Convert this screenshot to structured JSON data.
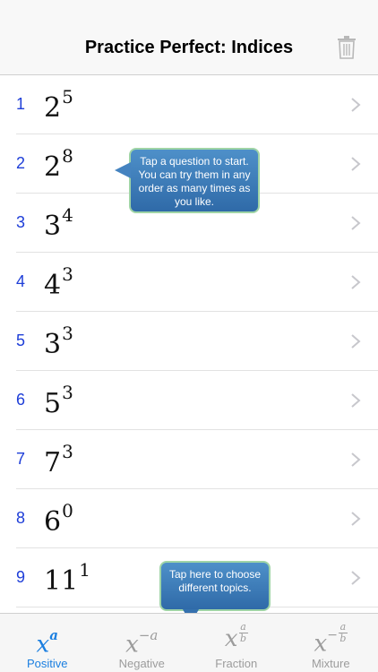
{
  "nav": {
    "title": "Practice Perfect: Indices",
    "trash_icon": "trash-icon"
  },
  "questions": [
    {
      "num": "1",
      "base": "2",
      "exp": "5"
    },
    {
      "num": "2",
      "base": "2",
      "exp": "8"
    },
    {
      "num": "3",
      "base": "3",
      "exp": "4"
    },
    {
      "num": "4",
      "base": "4",
      "exp": "3"
    },
    {
      "num": "5",
      "base": "3",
      "exp": "3"
    },
    {
      "num": "6",
      "base": "5",
      "exp": "3"
    },
    {
      "num": "7",
      "base": "7",
      "exp": "3"
    },
    {
      "num": "8",
      "base": "6",
      "exp": "0"
    },
    {
      "num": "9",
      "base": "11",
      "exp": "1"
    }
  ],
  "tooltips": {
    "start": "Tap a question to start. You can try them in any order as many times as you like.",
    "topics": "Tap here to choose different topics."
  },
  "tabs": [
    {
      "label": "Positive",
      "base": "x",
      "exp": "a",
      "active": true
    },
    {
      "label": "Negative",
      "base": "x",
      "exp": "−a",
      "active": false
    },
    {
      "label": "Fraction",
      "base": "x",
      "num": "a",
      "den": "b",
      "active": false
    },
    {
      "label": "Mixture",
      "base": "x",
      "sign": "−",
      "num": "a",
      "den": "b",
      "active": false
    }
  ],
  "colors": {
    "accent": "#1b7fe0",
    "number": "#1e3ed8",
    "inactive": "#9c9c9c",
    "tooltip": "#3a78b8"
  }
}
